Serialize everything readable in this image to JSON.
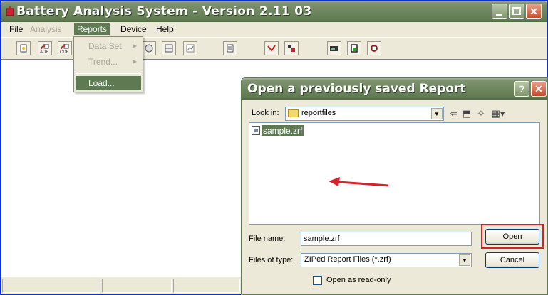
{
  "window": {
    "title": "Battery Analysis System - Version 2.11 03"
  },
  "menubar": {
    "file": "File",
    "analysis": "Analysis",
    "reports": "Reports",
    "device": "Device",
    "help": "Help"
  },
  "toolbar": {
    "adf_label": "ADF",
    "cdf_label": "CDF"
  },
  "reports_menu": {
    "items": [
      {
        "label": "Data Set",
        "submenu": true,
        "enabled": false
      },
      {
        "label": "Trend...",
        "submenu": true,
        "enabled": false
      },
      {
        "label": "Load...",
        "submenu": false,
        "enabled": true
      }
    ]
  },
  "dialog": {
    "title": "Open a previously saved Report",
    "look_in_label": "Look in:",
    "look_in_value": "reportfiles",
    "files": [
      "sample.zrf"
    ],
    "file_name_label": "File name:",
    "file_name_value": "sample.zrf",
    "files_of_type_label": "Files of type:",
    "files_of_type_value": "ZIPed Report Files (*.zrf)",
    "open_button": "Open",
    "cancel_button": "Cancel",
    "readonly_label": "Open as read-only",
    "readonly_checked": false
  },
  "colors": {
    "titlebar": "#6e8760",
    "selection": "#5e7a52",
    "annotation": "#d3222a"
  }
}
